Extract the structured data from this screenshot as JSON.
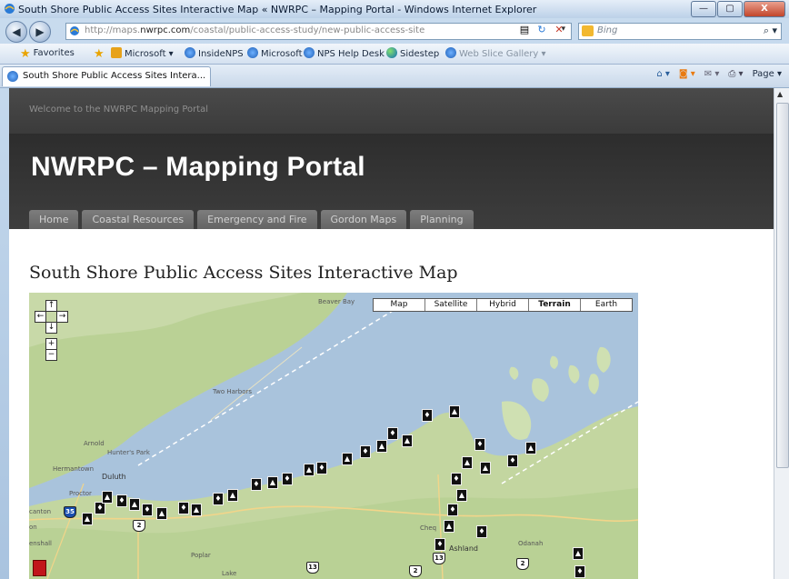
{
  "window": {
    "title": "South Shore Public Access Sites Interactive Map « NWRPC – Mapping Portal - Windows Internet Explorer",
    "controls": {
      "minimize": "—",
      "maximize": "▢",
      "close": "X"
    }
  },
  "address_bar": {
    "url_prefix": "http://maps.",
    "url_domain": "nwrpc.com",
    "url_path": "/coastal/public-access-study/new-public-access-site",
    "search_placeholder": "Bing"
  },
  "favorites_bar": {
    "favorites_label": "Favorites",
    "items": [
      {
        "label": "Microsoft ▾",
        "icon": "microsoft-icon"
      },
      {
        "label": "InsideNPS",
        "icon": "ie-icon"
      },
      {
        "label": "Microsoft",
        "icon": "ie-icon"
      },
      {
        "label": "NPS Help Desk",
        "icon": "ie-icon"
      },
      {
        "label": "Sidestep",
        "icon": "globe-icon"
      },
      {
        "label": "Web Slice Gallery ▾",
        "icon": "ie-icon"
      }
    ]
  },
  "tabs": [
    {
      "label": "South Shore Public Access Sites Intera..."
    }
  ],
  "command_bar": {
    "page_label": "Page ▾"
  },
  "site": {
    "welcome": "Welcome to the NWRPC Mapping Portal",
    "title": "NWRPC – Mapping Portal",
    "nav": [
      "Home",
      "Coastal Resources",
      "Emergency and Fire",
      "Gordon Maps",
      "Planning"
    ]
  },
  "page": {
    "title": "South Shore Public Access Sites Interactive Map"
  },
  "map": {
    "types": [
      "Map",
      "Satellite",
      "Hybrid",
      "Terrain",
      "Earth"
    ],
    "active_type": "Terrain",
    "place_labels": [
      "Beaver Bay",
      "Two Harbors",
      "Arnold",
      "Hunter's Park",
      "Hermantown",
      "Duluth",
      "Proctor",
      "canton",
      "on",
      "enshall",
      "Poplar",
      "Lake",
      "Cheq",
      "Ashland",
      "Odanah"
    ],
    "highway_shields": [
      "35",
      "2",
      "13",
      "2",
      "13",
      "2"
    ]
  }
}
